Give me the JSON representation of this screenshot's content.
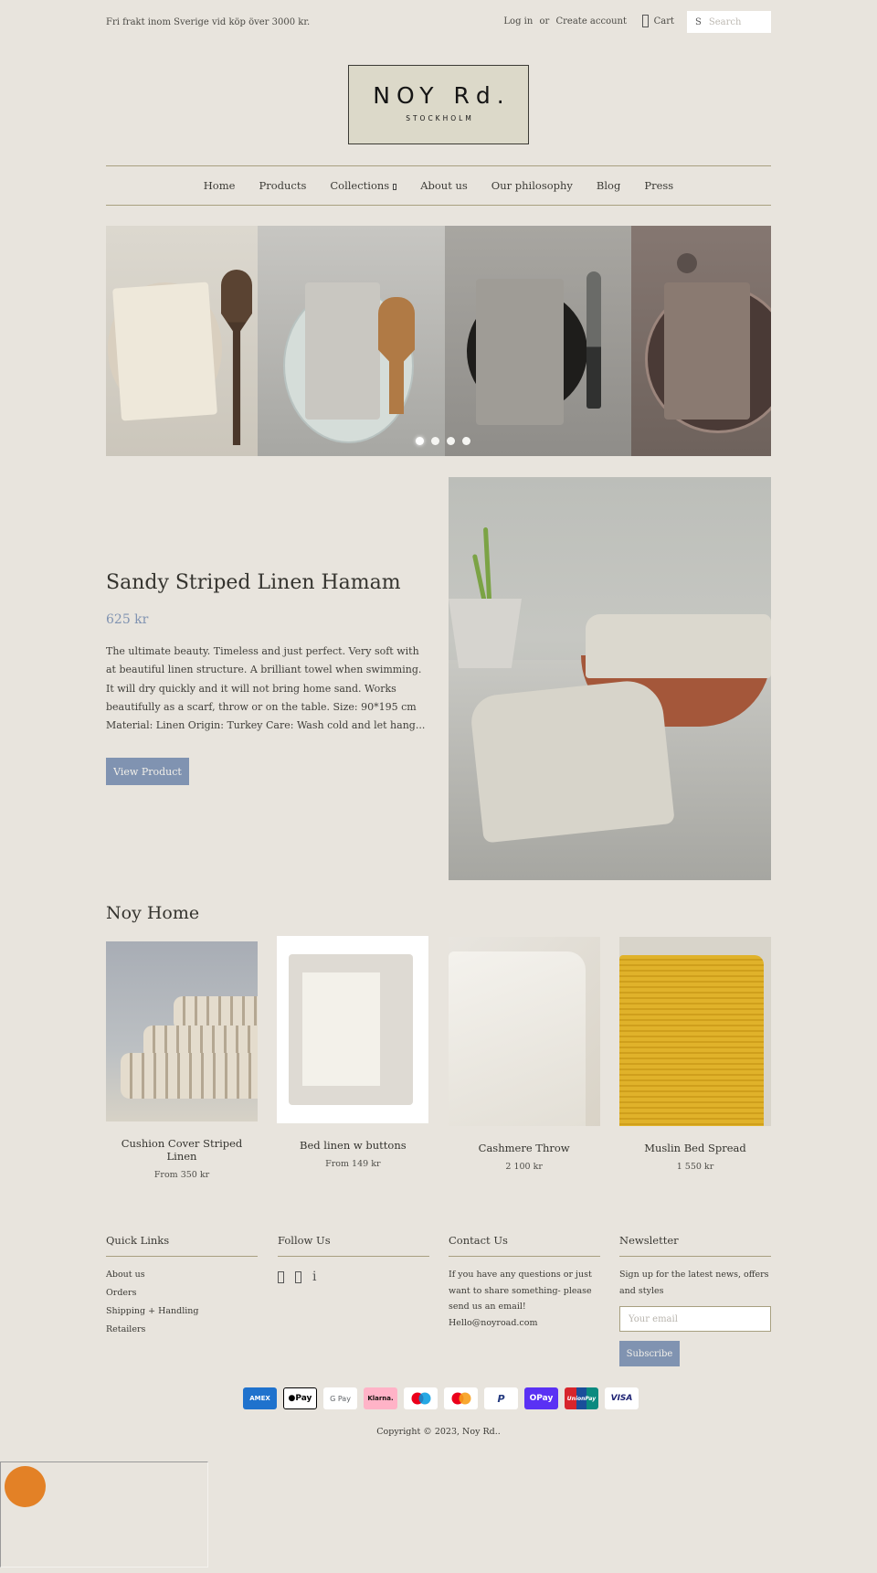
{
  "topbar": {
    "promo": "Fri frakt inom Sverige vid köp över 3000 kr.",
    "login": "Log in",
    "or": "or",
    "create_account": "Create account",
    "cart": "Cart",
    "search_icon": "S",
    "search_placeholder": "Search"
  },
  "logo": {
    "name": "NOY Rd.",
    "city": "STOCKHOLM"
  },
  "nav": {
    "items": [
      "Home",
      "Products",
      "Collections",
      "About us",
      "Our philosophy",
      "Blog",
      "Press"
    ]
  },
  "slideshow": {
    "slide_count": 4,
    "active_index": 0
  },
  "featured": {
    "title": "Sandy Striped Linen Hamam",
    "price": "625 kr",
    "description": "The ultimate beauty. Timeless and just perfect. Very soft with at beautiful linen structure. A brilliant towel when swimming. It will dry quickly and it will not bring home sand. Works beautifully as a scarf, throw or on the table. Size: 90*195 cm Material: Linen Origin: Turkey Care: Wash cold and let hang...",
    "button": "View Product"
  },
  "collection": {
    "title": "Noy Home",
    "products": [
      {
        "name": "Cushion Cover Striped Linen",
        "price": "From 350 kr"
      },
      {
        "name": "Bed linen w buttons",
        "price": "From 149 kr"
      },
      {
        "name": "Cashmere Throw",
        "price": "2 100 kr"
      },
      {
        "name": "Muslin Bed Spread",
        "price": "1 550 kr"
      }
    ]
  },
  "footer": {
    "quick_links": {
      "title": "Quick Links",
      "items": [
        "About us",
        "Orders",
        "Shipping + Handling",
        "Retailers"
      ]
    },
    "follow": {
      "title": "Follow Us",
      "icons": [
        "facebook-icon",
        "instagram-icon",
        "pinterest-icon"
      ],
      "pinterest_glyph": "i"
    },
    "contact": {
      "title": "Contact Us",
      "text": "If you have any questions or just want to share something- please send us an email! Hello@noyroad.com"
    },
    "newsletter": {
      "title": "Newsletter",
      "text": "Sign up for the latest news, offers and styles",
      "placeholder": "Your email",
      "button": "Subscribe"
    }
  },
  "payments": [
    {
      "name": "AMEX",
      "bg": "#1f72cd",
      "fg": "#ffffff"
    },
    {
      "name": "Pay",
      "bg": "#ffffff",
      "fg": "#000000"
    },
    {
      "name": "G Pay",
      "bg": "#ffffff",
      "fg": "#5f6368"
    },
    {
      "name": "Klarna.",
      "bg": "#ffb3c7",
      "fg": "#17120f"
    },
    {
      "name": "maestro",
      "bg": "#ffffff",
      "fg": "#000000"
    },
    {
      "name": "mastercard",
      "bg": "#ffffff",
      "fg": "#000000"
    },
    {
      "name": "P",
      "bg": "#ffffff",
      "fg": "#253b80"
    },
    {
      "name": "OPay",
      "bg": "#5a31f4",
      "fg": "#ffffff"
    },
    {
      "name": "UnionPay",
      "bg": "#d7252c",
      "fg": "#ffffff"
    },
    {
      "name": "VISA",
      "bg": "#ffffff",
      "fg": "#1a1f71"
    }
  ],
  "copyright": "Copyright © 2023, Noy Rd..",
  "colors": {
    "background": "#e8e4dd",
    "accent_blue": "#8093b1",
    "divider": "#a8a080",
    "widget_orange": "#e38126"
  }
}
